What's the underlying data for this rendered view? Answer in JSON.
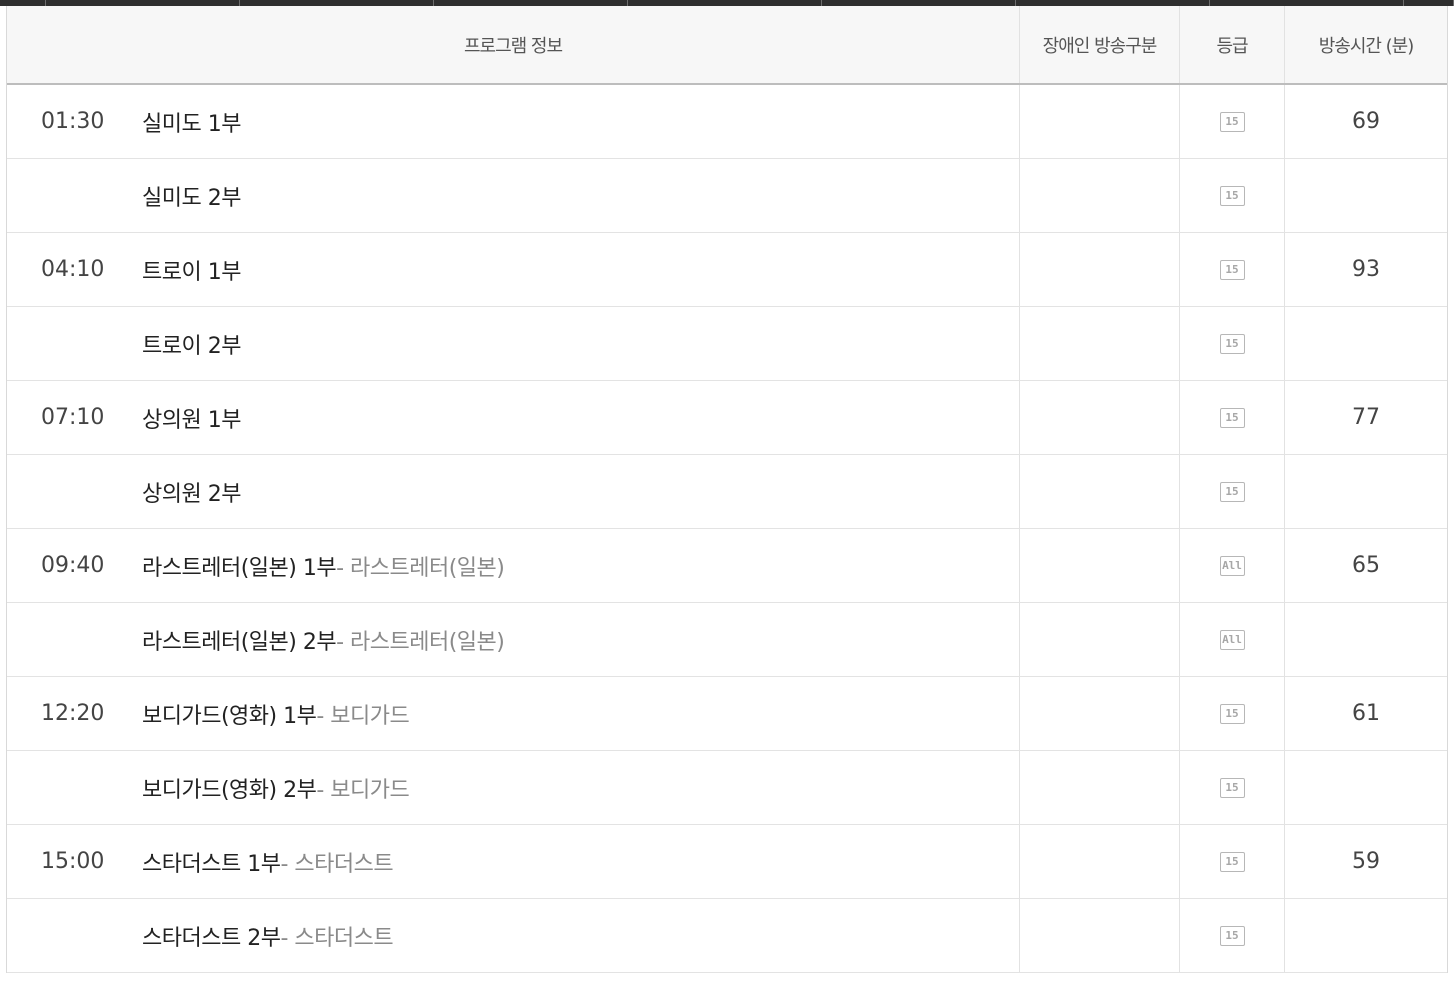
{
  "header": {
    "program_info": "프로그램 정보",
    "accessibility": "장애인 방송구분",
    "grade": "등급",
    "duration": "방송시간 (분)"
  },
  "colors": {
    "header_bg": "#f7f7f7",
    "subtitle": "#8a8a8a",
    "nav": "#2f2f2f"
  },
  "rows": [
    {
      "time": "01:30",
      "title": "실미도 1부",
      "sub": "",
      "grade": "15",
      "grade_icon": "rating-15-icon",
      "duration": "69"
    },
    {
      "time": "",
      "title": "실미도 2부",
      "sub": "",
      "grade": "15",
      "grade_icon": "rating-15-icon",
      "duration": ""
    },
    {
      "time": "04:10",
      "title": "트로이 1부",
      "sub": "",
      "grade": "15",
      "grade_icon": "rating-15-icon",
      "duration": "93"
    },
    {
      "time": "",
      "title": "트로이 2부",
      "sub": "",
      "grade": "15",
      "grade_icon": "rating-15-icon",
      "duration": ""
    },
    {
      "time": "07:10",
      "title": "상의원 1부",
      "sub": "",
      "grade": "15",
      "grade_icon": "rating-15-icon",
      "duration": "77"
    },
    {
      "time": "",
      "title": "상의원 2부",
      "sub": "",
      "grade": "15",
      "grade_icon": "rating-15-icon",
      "duration": ""
    },
    {
      "time": "09:40",
      "title": "라스트레터(일본) 1부",
      "sub": " - 라스트레터(일본)",
      "grade": "All",
      "grade_icon": "rating-all-icon",
      "duration": "65"
    },
    {
      "time": "",
      "title": "라스트레터(일본) 2부",
      "sub": " - 라스트레터(일본)",
      "grade": "All",
      "grade_icon": "rating-all-icon",
      "duration": ""
    },
    {
      "time": "12:20",
      "title": "보디가드(영화) 1부",
      "sub": " - 보디가드",
      "grade": "15",
      "grade_icon": "rating-15-icon",
      "duration": "61"
    },
    {
      "time": "",
      "title": "보디가드(영화) 2부",
      "sub": " - 보디가드",
      "grade": "15",
      "grade_icon": "rating-15-icon",
      "duration": ""
    },
    {
      "time": "15:00",
      "title": "스타더스트 1부",
      "sub": " - 스타더스트",
      "grade": "15",
      "grade_icon": "rating-15-icon",
      "duration": "59"
    },
    {
      "time": "",
      "title": "스타더스트 2부",
      "sub": " - 스타더스트",
      "grade": "15",
      "grade_icon": "rating-15-icon",
      "duration": ""
    }
  ]
}
